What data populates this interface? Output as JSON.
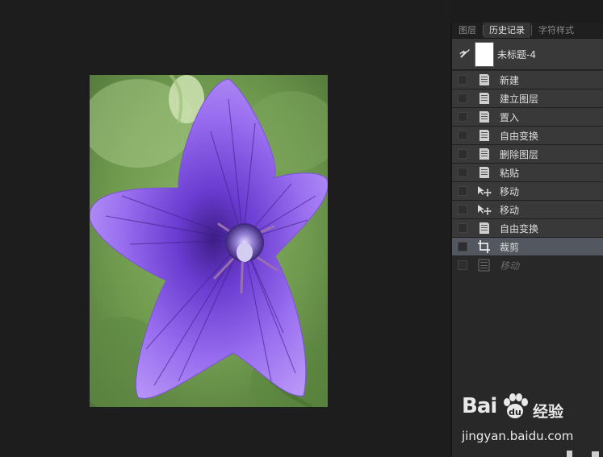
{
  "panel": {
    "tabs": [
      "图层",
      "历史记录",
      "字符样式"
    ],
    "active_tab": 1,
    "snapshot": {
      "label": "未标题-4",
      "icon": "history-brush-icon"
    },
    "history": [
      {
        "label": "新建",
        "icon": "document-icon",
        "state": "normal"
      },
      {
        "label": "建立图层",
        "icon": "document-icon",
        "state": "normal"
      },
      {
        "label": "置入",
        "icon": "document-icon",
        "state": "normal"
      },
      {
        "label": "自由变换",
        "icon": "document-icon",
        "state": "normal"
      },
      {
        "label": "删除图层",
        "icon": "document-icon",
        "state": "normal"
      },
      {
        "label": "粘贴",
        "icon": "document-icon",
        "state": "normal"
      },
      {
        "label": "移动",
        "icon": "move-tool-icon",
        "state": "normal"
      },
      {
        "label": "移动",
        "icon": "move-tool-icon",
        "state": "normal"
      },
      {
        "label": "自由变换",
        "icon": "document-icon",
        "state": "normal"
      },
      {
        "label": "裁剪",
        "icon": "crop-tool-icon",
        "state": "selected"
      },
      {
        "label": "移动",
        "icon": "move-document-icon",
        "state": "inactive"
      }
    ]
  },
  "canvas": {
    "image": "purple-balloon-flower-photo"
  },
  "watermark": {
    "brand": "Bai",
    "brand_suffix": "经验",
    "url": "jingyan.baidu.com"
  }
}
